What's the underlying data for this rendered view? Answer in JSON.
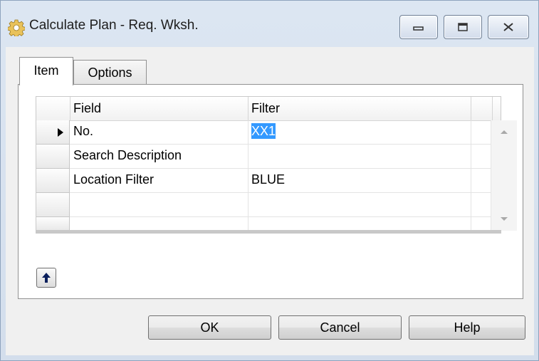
{
  "window": {
    "title": "Calculate Plan - Req. Wksh.",
    "icon": "gear-icon"
  },
  "tabs": [
    {
      "label": "Item",
      "active": true
    },
    {
      "label": "Options",
      "active": false
    }
  ],
  "grid": {
    "columns": [
      "Field",
      "Filter"
    ],
    "rows": [
      {
        "field": "No.",
        "filter": "XX1",
        "current": true
      },
      {
        "field": "Search Description",
        "filter": ""
      },
      {
        "field": "Location Filter",
        "filter": "BLUE"
      },
      {
        "field": "",
        "filter": ""
      },
      {
        "field": "",
        "filter": ""
      }
    ]
  },
  "buttons": {
    "ok": "OK",
    "cancel": "Cancel",
    "help": "Help"
  },
  "colors": {
    "selection": "#3399ff"
  }
}
